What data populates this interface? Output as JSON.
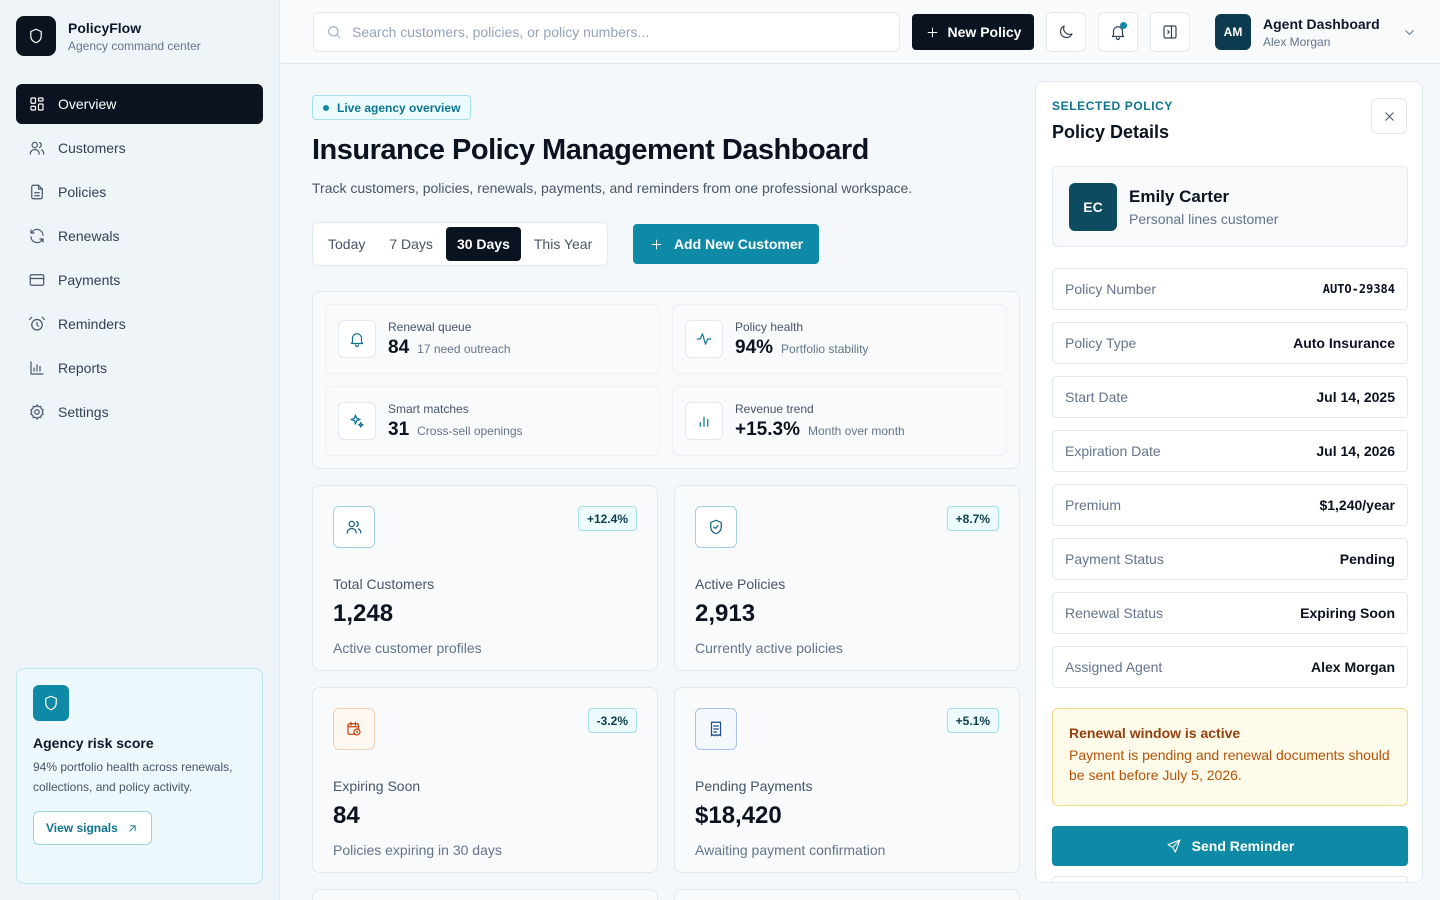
{
  "brand": {
    "name": "PolicyFlow",
    "subtitle": "Agency command center"
  },
  "nav": [
    {
      "label": "Overview",
      "icon": "grid-icon",
      "active": true
    },
    {
      "label": "Customers",
      "icon": "users-icon"
    },
    {
      "label": "Policies",
      "icon": "file-icon"
    },
    {
      "label": "Renewals",
      "icon": "refresh-icon"
    },
    {
      "label": "Payments",
      "icon": "card-icon"
    },
    {
      "label": "Reminders",
      "icon": "alarm-icon"
    },
    {
      "label": "Reports",
      "icon": "bar-chart-icon"
    },
    {
      "label": "Settings",
      "icon": "gear-icon"
    }
  ],
  "risk_card": {
    "title": "Agency risk score",
    "description": "94% portfolio health across renewals, collections, and policy activity.",
    "button": "View signals"
  },
  "topbar": {
    "search_placeholder": "Search customers, policies, or policy numbers...",
    "new_policy": "New Policy",
    "profile": {
      "initials": "AM",
      "title": "Agent Dashboard",
      "name": "Alex Morgan"
    }
  },
  "main": {
    "badge": "Live agency overview",
    "title": "Insurance Policy Management Dashboard",
    "subtitle": "Track customers, policies, renewals, payments, and reminders from one professional workspace.",
    "ranges": [
      "Today",
      "7 Days",
      "30 Days",
      "This Year"
    ],
    "active_range": "30 Days",
    "add_customer": "Add New Customer",
    "insights": [
      {
        "label": "Renewal queue",
        "value": "84",
        "note": "17 need outreach",
        "icon": "bell-icon"
      },
      {
        "label": "Policy health",
        "value": "94%",
        "note": "Portfolio stability",
        "icon": "activity-icon"
      },
      {
        "label": "Smart matches",
        "value": "31",
        "note": "Cross-sell openings",
        "icon": "sparkles-icon"
      },
      {
        "label": "Revenue trend",
        "value": "+15.3%",
        "note": "Month over month",
        "icon": "bar-chart-icon"
      }
    ],
    "stats": [
      {
        "label": "Total Customers",
        "value": "1,248",
        "note": "Active customer profiles",
        "change": "+12.4%",
        "icon": "users-icon"
      },
      {
        "label": "Active Policies",
        "value": "2,913",
        "note": "Currently active policies",
        "change": "+8.7%",
        "icon": "shield-check-icon"
      },
      {
        "label": "Expiring Soon",
        "value": "84",
        "note": "Policies expiring in 30 days",
        "change": "-3.2%",
        "icon": "calendar-clock-icon"
      },
      {
        "label": "Pending Payments",
        "value": "$18,420",
        "note": "Awaiting payment confirmation",
        "change": "+5.1%",
        "icon": "receipt-icon"
      }
    ]
  },
  "panel": {
    "eyebrow": "SELECTED POLICY",
    "title": "Policy Details",
    "customer": {
      "initials": "EC",
      "name": "Emily Carter",
      "type": "Personal lines customer"
    },
    "fields": [
      {
        "label": "Policy Number",
        "value": "AUTO-29384"
      },
      {
        "label": "Policy Type",
        "value": "Auto Insurance"
      },
      {
        "label": "Start Date",
        "value": "Jul 14, 2025"
      },
      {
        "label": "Expiration Date",
        "value": "Jul 14, 2026"
      },
      {
        "label": "Premium",
        "value": "$1,240/year"
      },
      {
        "label": "Payment Status",
        "value": "Pending"
      },
      {
        "label": "Renewal Status",
        "value": "Expiring Soon"
      },
      {
        "label": "Assigned Agent",
        "value": "Alex Morgan"
      }
    ],
    "alert": {
      "title": "Renewal window is active",
      "body": "Payment is pending and renewal documents should be sent before July 5, 2026."
    },
    "send_button": "Send Reminder"
  },
  "colors": {
    "accent": "#0e8aa7",
    "dark": "#0b1220",
    "warning_bg": "#fffbea"
  }
}
